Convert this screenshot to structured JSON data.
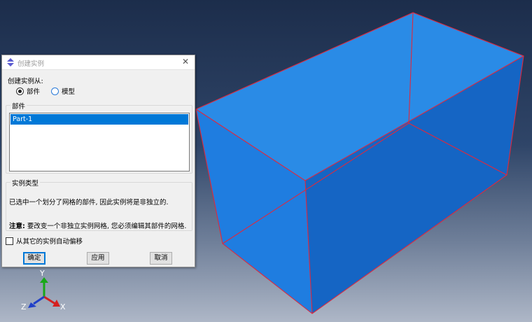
{
  "dialog": {
    "title": "创建实例",
    "create_from_label": "创建实例从:",
    "radio_part": "部件",
    "radio_model": "模型",
    "parts_group_label": "部件",
    "parts": [
      "Part-1"
    ],
    "instance_type_label": "实例类型",
    "message_line1": "已选中一个划分了网格的部件, 因此实例将是非独立的.",
    "note_label": "注意:",
    "note_text": "要改变一个非独立实例网格, 您必须编辑其部件的网格.",
    "auto_offset_label": "从其它的实例自动偏移",
    "auto_offset_checked": false,
    "ok_label": "确定",
    "apply_label": "应用",
    "cancel_label": "取消"
  },
  "viewport": {
    "axes": {
      "x": "X",
      "y": "Y",
      "z": "Z"
    },
    "box_face_color": "#1f7de0",
    "edge_color": "#e0283c"
  }
}
